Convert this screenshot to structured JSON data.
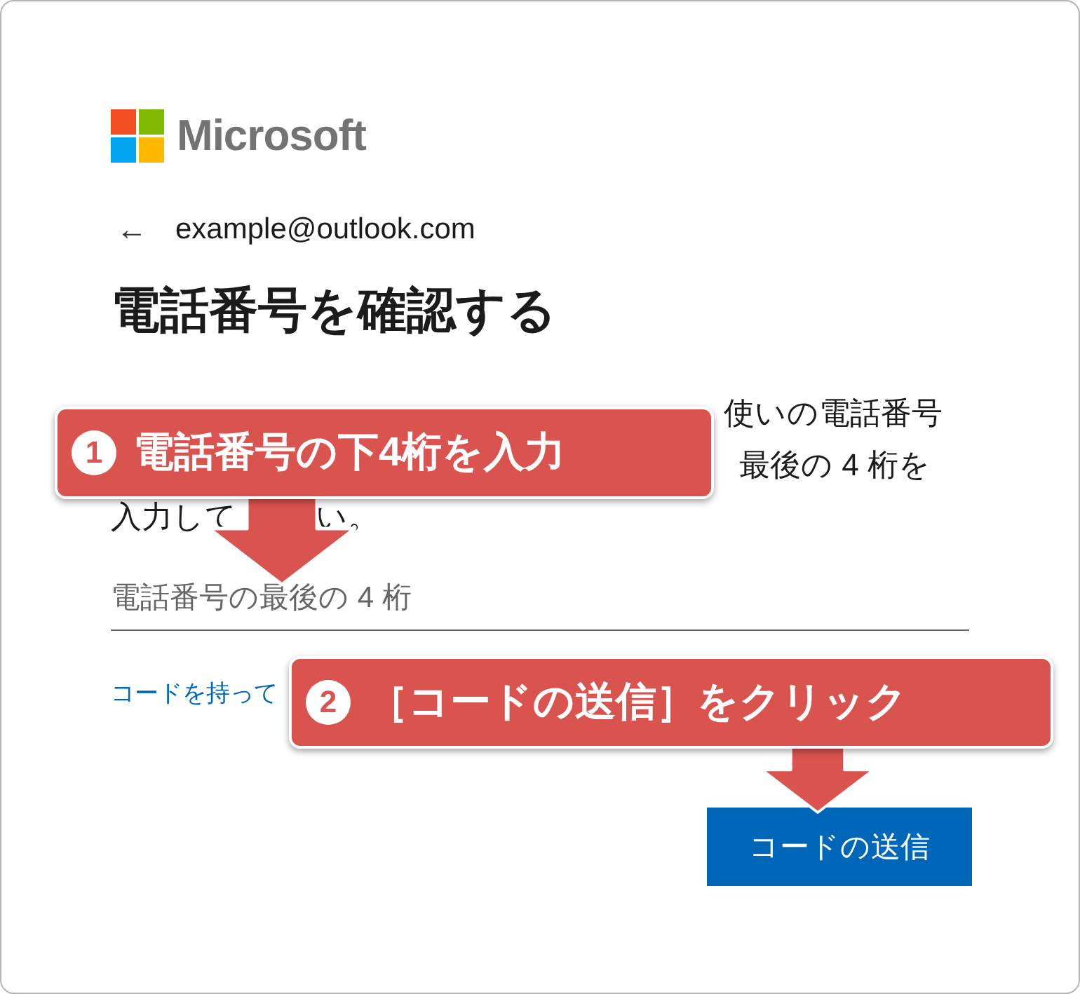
{
  "logo": {
    "name": "Microsoft"
  },
  "back": {
    "icon": "←",
    "account": "example@outlook.com"
  },
  "title": "電話番号を確認する",
  "description_lines": [
    {
      "fragments": [
        "使いの電話番号"
      ]
    },
    {
      "fragments": [
        "最後の 4 桁を"
      ]
    },
    {
      "fragments": [
        "入力して",
        "い。"
      ]
    }
  ],
  "phone_field": {
    "placeholder": "電話番号の最後の 4 桁"
  },
  "link": "コードを持って",
  "button": "コードの送信",
  "callouts": [
    {
      "number": "1",
      "text": "電話番号の下4桁を入力"
    },
    {
      "number": "2",
      "text": "［コードの送信］をクリック"
    }
  ]
}
